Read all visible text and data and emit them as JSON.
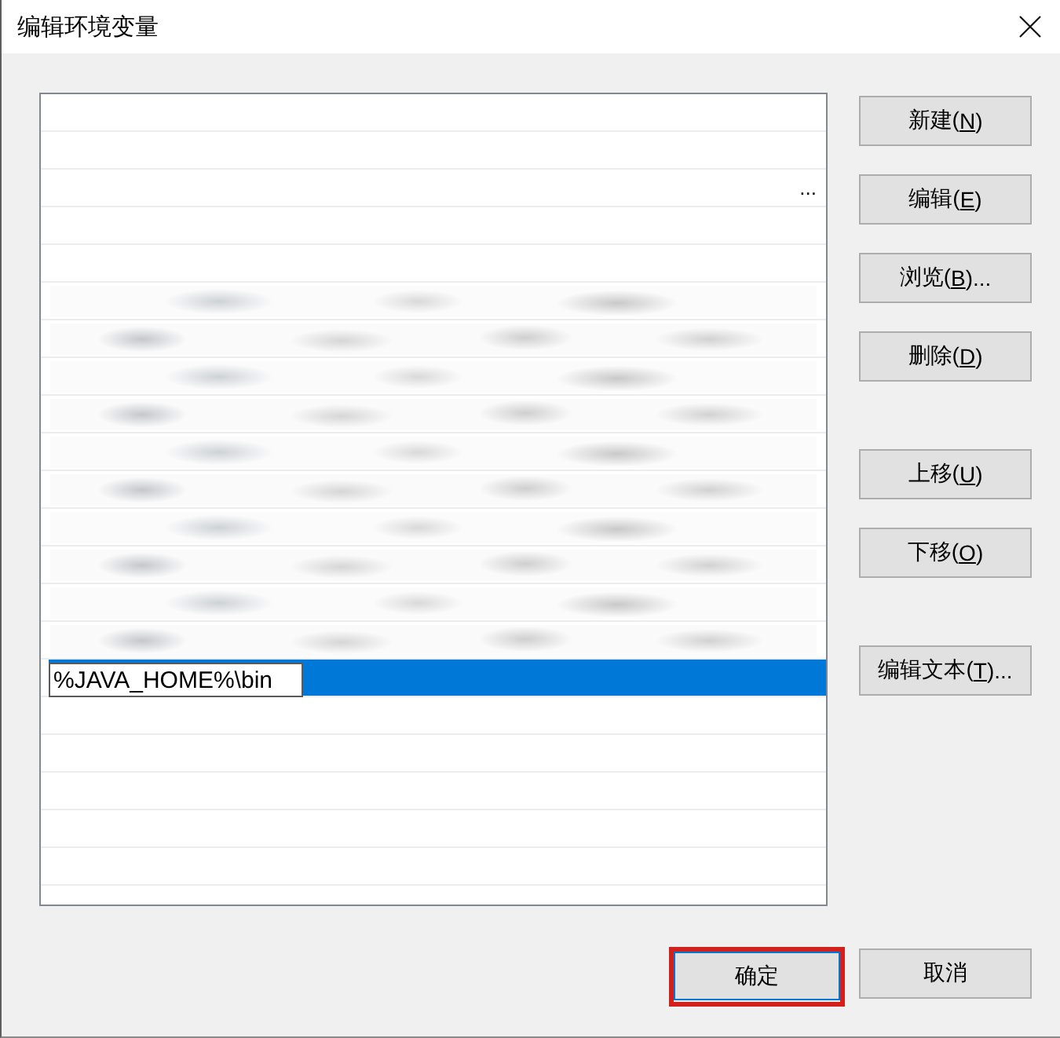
{
  "window": {
    "title": "编辑环境变量"
  },
  "path_list": {
    "rows": [
      {
        "kind": "blank",
        "selected": false
      },
      {
        "kind": "blank",
        "selected": false
      },
      {
        "kind": "truncated",
        "text": "...",
        "selected": false
      },
      {
        "kind": "blank",
        "selected": false
      },
      {
        "kind": "blank",
        "selected": false
      },
      {
        "kind": "blurred",
        "selected": false
      },
      {
        "kind": "blurred",
        "selected": false
      },
      {
        "kind": "blurred",
        "selected": false
      },
      {
        "kind": "blurred",
        "selected": false
      },
      {
        "kind": "blurred",
        "selected": false
      },
      {
        "kind": "blurred",
        "selected": false
      },
      {
        "kind": "blurred",
        "selected": false
      },
      {
        "kind": "blurred",
        "selected": false
      },
      {
        "kind": "blurred",
        "selected": false
      },
      {
        "kind": "blurred",
        "selected": false
      },
      {
        "kind": "editing",
        "value": "%JAVA_HOME%\\bin",
        "selected": true
      },
      {
        "kind": "blank",
        "selected": false
      },
      {
        "kind": "blank",
        "selected": false
      },
      {
        "kind": "blank",
        "selected": false
      },
      {
        "kind": "blank",
        "selected": false
      },
      {
        "kind": "blank",
        "selected": false
      }
    ]
  },
  "button_groups": [
    [
      {
        "text": "新建(",
        "key": "N",
        "after": ")"
      },
      {
        "text": "编辑(",
        "key": "E",
        "after": ")"
      },
      {
        "text": "浏览(",
        "key": "B",
        "after": ")..."
      },
      {
        "text": "删除(",
        "key": "D",
        "after": ")"
      }
    ],
    [
      {
        "text": "上移(",
        "key": "U",
        "after": ")"
      },
      {
        "text": "下移(",
        "key": "O",
        "after": ")"
      }
    ],
    [
      {
        "text": "编辑文本(",
        "key": "T",
        "after": ")..."
      }
    ]
  ],
  "dialog_buttons": [
    {
      "text": "确定",
      "default": true,
      "highlighted": true
    },
    {
      "text": "取消",
      "default": false,
      "highlighted": false
    }
  ]
}
